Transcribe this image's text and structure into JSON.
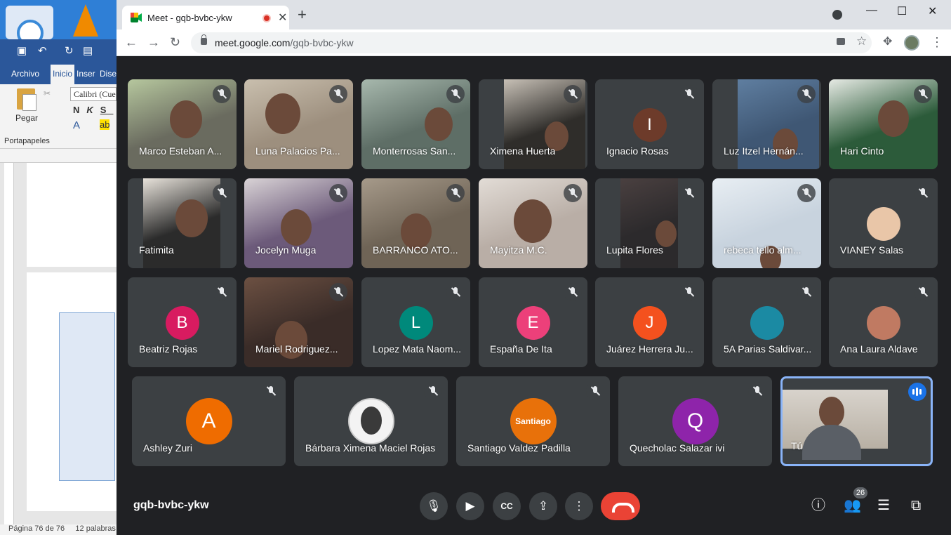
{
  "word": {
    "tab_archivo": "Archivo",
    "tab_inicio": "Inicio",
    "tab_insertar": "Inser",
    "tab_diseno": "Dise",
    "paste_label": "Pegar",
    "font_name": "Calibri (Cue",
    "bold": "N",
    "italic": "K",
    "underline": "S",
    "clipboard_group": "Portapapeles",
    "status_page": "Página 76 de 76",
    "status_words": "12 palabras"
  },
  "browser": {
    "tab_title": "Meet - gqb-bvbc-ykw",
    "url_host": "meet.google.com",
    "url_path": "/gqb-bvbc-ykw"
  },
  "meet": {
    "participants": [
      {
        "name": "Marco Esteban A..."
      },
      {
        "name": "Luna Palacios Pa..."
      },
      {
        "name": "Monterrosas San..."
      },
      {
        "name": "Ximena Huerta"
      },
      {
        "name": "Ignacio Rosas",
        "initial": "I",
        "color": "#6d3b2a"
      },
      {
        "name": "Luz Itzel Hernán..."
      },
      {
        "name": "Hari Cinto"
      },
      {
        "name": "Fatimita"
      },
      {
        "name": "Jocelyn Muga"
      },
      {
        "name": "BARRANCO ATO..."
      },
      {
        "name": "Mayitza M.C."
      },
      {
        "name": "Lupita Flores"
      },
      {
        "name": "rebeca tello alm..."
      },
      {
        "name": "VIANEY Salas"
      },
      {
        "name": "Beatriz Rojas",
        "initial": "B",
        "color": "#d81b60"
      },
      {
        "name": "Mariel Rodriguez..."
      },
      {
        "name": "Lopez Mata Naom...",
        "initial": "L",
        "color": "#00897b"
      },
      {
        "name": "España De Ita",
        "initial": "E",
        "color": "#ec407a"
      },
      {
        "name": "Juárez Herrera Ju...",
        "initial": "J",
        "color": "#f4511e"
      },
      {
        "name": "5A Parias Saldivar..."
      },
      {
        "name": "Ana Laura Aldave"
      }
    ],
    "bottom_row": [
      {
        "name": "Ashley Zuri",
        "initial": "A",
        "color": "#ef6c00"
      },
      {
        "name": "Bárbara Ximena Maciel Rojas"
      },
      {
        "name": "Santiago Valdez Padilla",
        "avatar_text": "Santiago",
        "color": "#e8710a"
      },
      {
        "name": "Quecholac Salazar ivi",
        "initial": "Q",
        "color": "#8e24aa"
      }
    ],
    "self_label": "Tú",
    "meeting_code": "gqb-bvbc-ykw",
    "participant_count": "26"
  }
}
